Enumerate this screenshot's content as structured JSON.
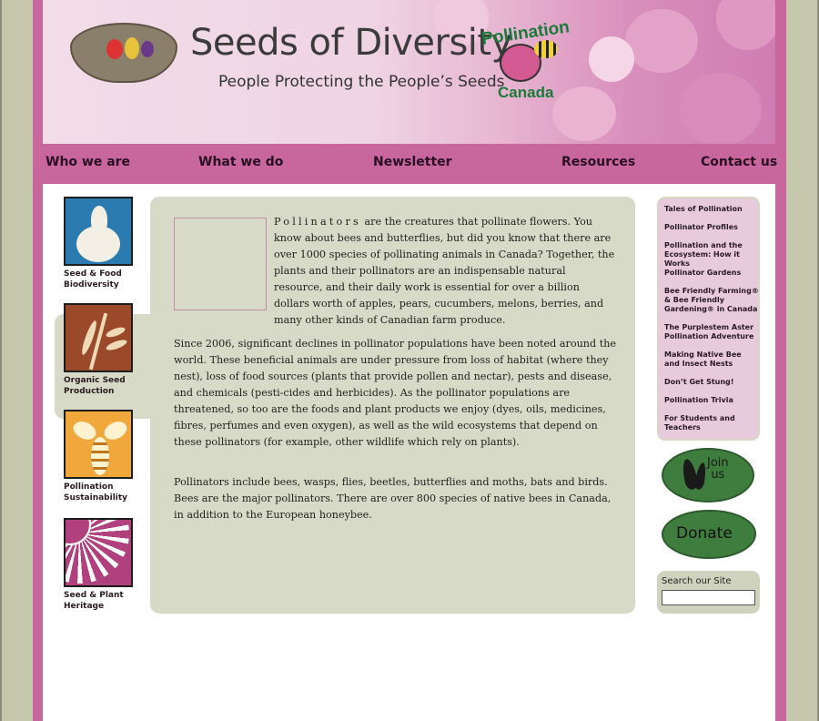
{
  "site": {
    "title": "Seeds of Diversity",
    "tagline": "People Protecting the People’s Seeds",
    "partner_top": "Pollination",
    "partner_bottom": "Canada"
  },
  "nav": [
    "Who we are",
    "What we do",
    "Newsletter",
    "Resources",
    "Contact us"
  ],
  "categories": [
    {
      "label1": "Seed & Food",
      "label2": "Biodiversity",
      "icon": "garlic-icon",
      "color": "#2b7bb0"
    },
    {
      "label1": "Organic Seed",
      "label2": "Production",
      "icon": "wheat-icon",
      "color": "#9a4a2a"
    },
    {
      "label1": "Pollination",
      "label2": "Sustainability",
      "icon": "bee-icon",
      "color": "#f0a83c"
    },
    {
      "label1": "Seed & Plant",
      "label2": "Heritage",
      "icon": "sunflower-icon",
      "color": "#b0407e"
    }
  ],
  "content": {
    "p1_lead": "Pollinators",
    "p1_rest": " are the creatures that pollinate flowers. You know about bees and butterflies, but did you know that there are over 1000 species of pollinating animals in Canada? Together, the plants and their pollinators are an indispensable natural resource, and their daily work is essential for over a billion dollars worth of apples, pears, cucumbers, melons, berries, and many other kinds of Canadian farm produce.",
    "p2": "Since 2006, significant declines in pollinator populations have been noted around the world. These beneficial animals are under pressure from loss of habitat (where they nest), loss of food sources (plants that provide pollen and nectar), pests and disease, and chemicals (pesti-cides and herbicides). As the pollinator populations are threatened, so too are the foods and plant products we enjoy (dyes, oils, medicines, fibres, perfumes and even oxygen), as well as the wild ecosystems that depend on these pollinators (for example, other wildlife which rely on plants).",
    "p3": "Pollinators include bees, wasps, flies, beetles, butterflies and moths, bats and birds. Bees are the major pollinators. There are over 800 species of native bees in Canada, in addition to the European honeybee."
  },
  "side_menu": [
    "Tales of Pollination",
    "Pollinator Profiles",
    "Pollination and the Ecosystem: How it Works",
    "Pollinator Gardens",
    "Bee Friendly Farming® & Bee Friendly Gardening® in Canada",
    "The Purplestem Aster Pollination Adventure",
    "Making Native Bee and Insect Nests",
    "Don’t Get Stung!",
    "Pollination Trivia",
    "For Students and Teachers"
  ],
  "join": {
    "line1": "Join",
    "line2": "us"
  },
  "donate": "Donate",
  "search": {
    "label": "Search our Site",
    "value": ""
  }
}
